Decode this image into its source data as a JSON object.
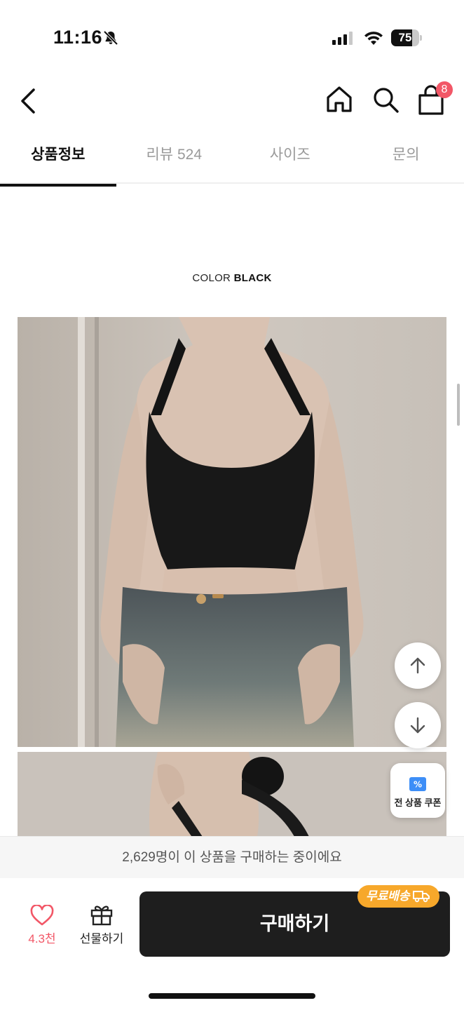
{
  "status_bar": {
    "time": "11:16",
    "battery_level": "75",
    "battery_fraction": 0.75,
    "icons": [
      "bell-off-icon",
      "cellular-signal-icon",
      "wifi-icon",
      "battery-icon"
    ]
  },
  "header": {
    "icons": [
      "back-arrow-icon",
      "home-icon",
      "search-icon",
      "shopping-bag-icon"
    ],
    "cart_count": "8"
  },
  "tabs": [
    {
      "label": "상품정보",
      "active": true
    },
    {
      "label": "리뷰 524",
      "active": false
    },
    {
      "label": "사이즈",
      "active": false
    },
    {
      "label": "문의",
      "active": false
    }
  ],
  "content": {
    "color_prefix": "COLOR",
    "color_value": "BLACK"
  },
  "floating": {
    "coupon_label": "전 상품 쿠폰",
    "icons": [
      "arrow-up-icon",
      "arrow-down-icon",
      "coupon-icon"
    ]
  },
  "notice": {
    "text": "2,629명이 이 상품을 구매하는 중이에요"
  },
  "bottom_bar": {
    "like_count": "4.3천",
    "gift_label": "선물하기",
    "buy_label": "구매하기",
    "free_shipping_label": "무료배송",
    "icons": [
      "heart-icon",
      "gift-icon",
      "truck-icon"
    ]
  },
  "colors": {
    "accent_pink": "#f25767",
    "shipping_orange": "#f7a82b",
    "buy_button": "#1e1e1e"
  }
}
